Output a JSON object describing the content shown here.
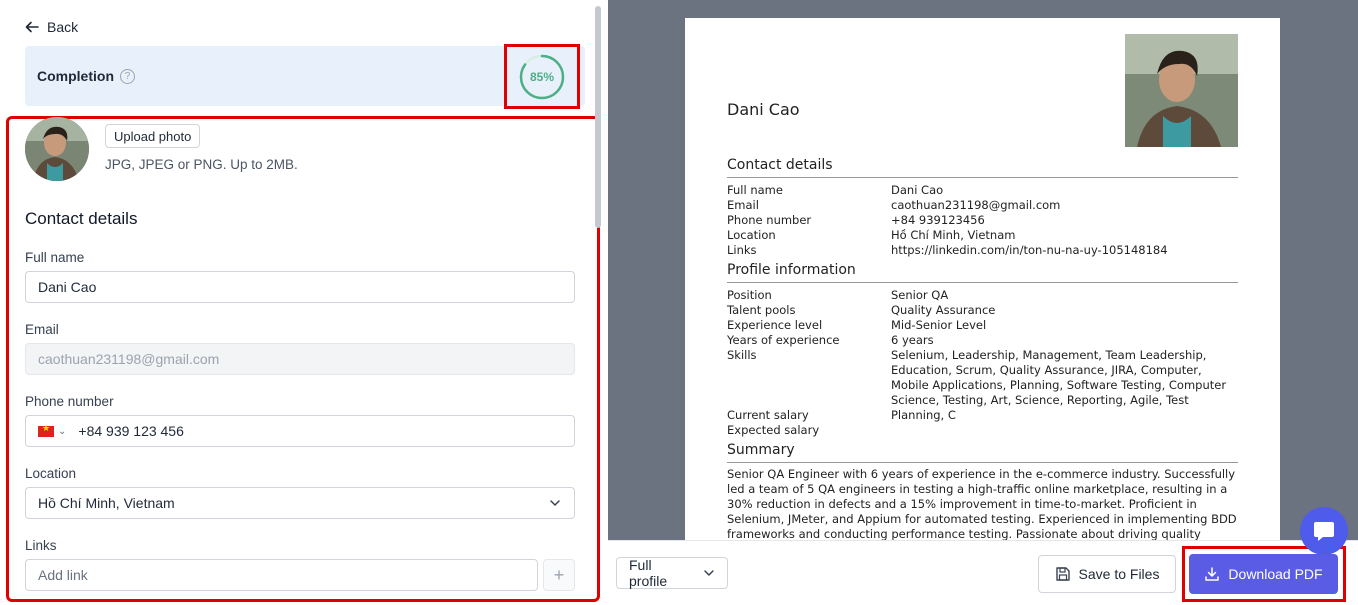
{
  "left": {
    "back_label": "Back",
    "completion_label": "Completion",
    "completion_value": "85%",
    "completion_fraction": 0.85,
    "upload_button": "Upload photo",
    "upload_hint": "JPG, JPEG or PNG. Up to 2MB.",
    "section_title": "Contact details",
    "fields": {
      "full_name": {
        "label": "Full name",
        "value": "Dani Cao"
      },
      "email": {
        "label": "Email",
        "value": "caothuan231198@gmail.com"
      },
      "phone": {
        "label": "Phone number",
        "value": "+84 939 123 456"
      },
      "location": {
        "label": "Location",
        "value": "Hồ Chí Minh, Vietnam"
      },
      "links": {
        "label": "Links",
        "placeholder": "Add link"
      }
    }
  },
  "cv": {
    "name": "Dani Cao",
    "contact_title": "Contact details",
    "contact": [
      {
        "k": "Full name",
        "v": "Dani Cao"
      },
      {
        "k": "Email",
        "v": "caothuan231198@gmail.com"
      },
      {
        "k": "Phone number",
        "v": "+84 939123456"
      },
      {
        "k": "Location",
        "v": "Hồ Chí Minh, Vietnam"
      },
      {
        "k": "Links",
        "v": "https://linkedin.com/in/ton-nu-na-uy-105148184"
      }
    ],
    "profile_title": "Profile information",
    "profile": [
      {
        "k": "Position",
        "v": "Senior QA"
      },
      {
        "k": "Talent pools",
        "v": "Quality Assurance"
      },
      {
        "k": "Experience level",
        "v": "Mid-Senior Level"
      },
      {
        "k": "Years of experience",
        "v": "6 years"
      },
      {
        "k": "Skills",
        "v": "Selenium, Leadership, Management, Team Leadership, Education, Scrum, Quality Assurance, JIRA, Computer, Mobile Applications, Planning, Software Testing, Computer Science, Testing, Art, Science, Reporting, Agile, Test Planning, C"
      },
      {
        "k": "Current salary",
        "v": ""
      },
      {
        "k": "Expected salary",
        "v": ""
      }
    ],
    "summary_title": "Summary",
    "summary": "Senior QA Engineer with 6 years of experience in the e-commerce industry. Successfully led  a team of 5 QA engineers in testing a high-traffic online marketplace, resulting in a 30% reduction in defects and a 15% improvement in time-to-market. Proficient in Selenium, JMeter, and Appium for automated testing. Experienced in implementing BDD frameworks and conducting performance testing. Passionate about driving quality throughout the"
  },
  "bottom": {
    "view_select": "Full profile",
    "save_files": "Save to Files",
    "download_pdf": "Download PDF"
  },
  "colors": {
    "accent": "#5b5ce6",
    "progress": "#4caf87",
    "highlight": "#e00000"
  }
}
